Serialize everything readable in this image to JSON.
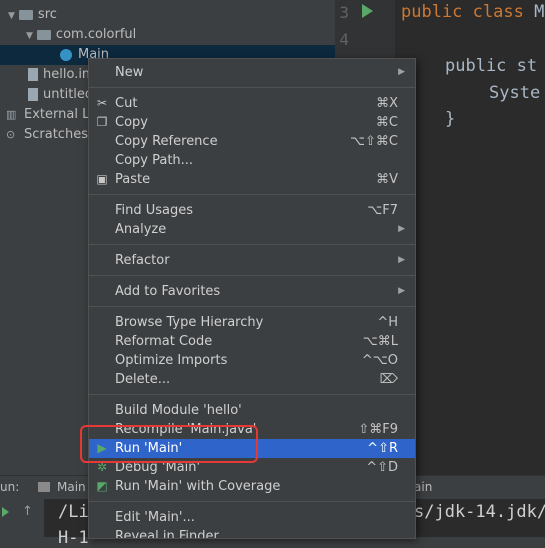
{
  "tree": {
    "src": "src",
    "package": "com.colorful",
    "main_class": "Main",
    "hello_file": "hello.im",
    "untitled": "untitled",
    "external_libs": "External Li",
    "scratches": "Scratches"
  },
  "editor": {
    "line_numbers": [
      "3",
      "4"
    ],
    "line1_keyword": "public class ",
    "line1_rest": "M",
    "line3_keyword": "public st",
    "line4": "Syste",
    "line5": "}"
  },
  "runbar": {
    "label": "un:",
    "tab": "Main",
    "right_text": "ain"
  },
  "console": {
    "line1": "/Li",
    "line1_right": "s/jdk-14.jdk/",
    "line2": "H-1"
  },
  "menu": {
    "items": [
      {
        "label": "New",
        "shortcut": "",
        "submenu": true
      },
      {
        "label": "Cut",
        "shortcut": "⌘X",
        "icon": "scissors-icon"
      },
      {
        "label": "Copy",
        "shortcut": "⌘C",
        "icon": "copy-icon"
      },
      {
        "label": "Copy Reference",
        "shortcut": "⌥⇧⌘C"
      },
      {
        "label": "Copy Path...",
        "shortcut": ""
      },
      {
        "label": "Paste",
        "shortcut": "⌘V",
        "icon": "paste-icon"
      },
      {
        "label": "Find Usages",
        "shortcut": "⌥F7"
      },
      {
        "label": "Analyze",
        "shortcut": "",
        "submenu": true
      },
      {
        "label": "Refactor",
        "shortcut": "",
        "submenu": true
      },
      {
        "label": "Add to Favorites",
        "shortcut": "",
        "submenu": true
      },
      {
        "label": "Browse Type Hierarchy",
        "shortcut": "^H"
      },
      {
        "label": "Reformat Code",
        "shortcut": "⌥⌘L"
      },
      {
        "label": "Optimize Imports",
        "shortcut": "^⌥O"
      },
      {
        "label": "Delete...",
        "shortcut": "⌦"
      },
      {
        "label": "Build Module 'hello'",
        "shortcut": ""
      },
      {
        "label": "Recompile 'Main.java'",
        "shortcut": "⇧⌘F9"
      },
      {
        "label": "Run 'Main'",
        "shortcut": "^⇧R",
        "icon": "run-icon"
      },
      {
        "label": "Debug 'Main'",
        "shortcut": "^⇧D",
        "icon": "debug-icon"
      },
      {
        "label": "Run 'Main' with Coverage",
        "shortcut": "",
        "icon": "coverage-icon"
      },
      {
        "label": "Edit 'Main'...",
        "shortcut": ""
      },
      {
        "label": "Reveal in Finder",
        "shortcut": ""
      }
    ]
  },
  "colors": {
    "highlight": "#2f65ca",
    "annotation_box": "#e53935",
    "keyword": "#cc7832",
    "run_green": "#59a869"
  }
}
